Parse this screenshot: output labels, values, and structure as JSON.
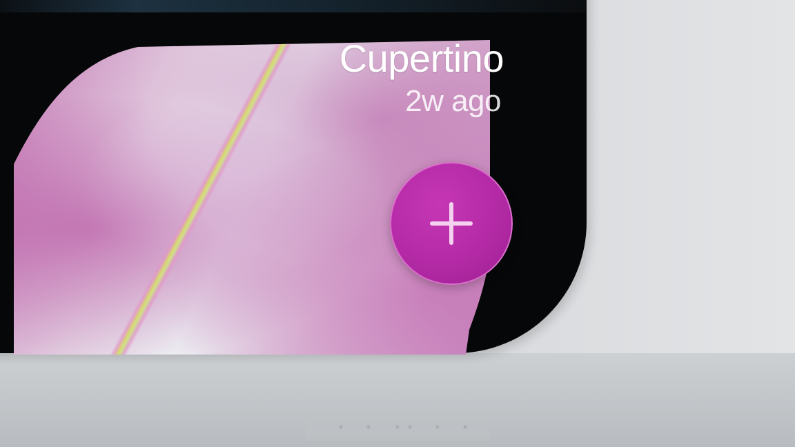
{
  "photo_card": {
    "location": "Cupertino",
    "time_ago": "2w ago"
  },
  "add_button": {
    "icon": "plus-icon",
    "color": "#b42aa6"
  },
  "colors": {
    "background": "#d8dadd",
    "device_frame": "#060708",
    "petal_pink": "#c77fb8"
  }
}
